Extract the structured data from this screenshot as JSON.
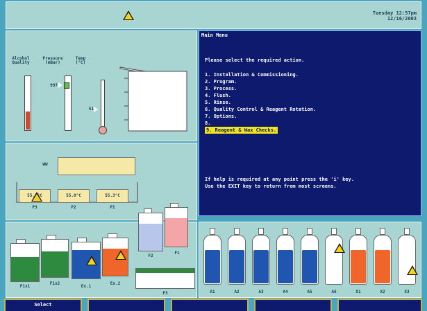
{
  "header": {
    "day_time": "Tuesday 12:57pm",
    "date": "12/16/2003",
    "alert_icon": "warning-triangle-icon"
  },
  "gauges": {
    "alcohol_label": "Alcohol\nQuality",
    "pressure_label": "Pressure\n(mBar)",
    "temp_label": "Temp\n(°C)",
    "pressure_value": "997",
    "temp_value": "51"
  },
  "wax": {
    "label": "WW",
    "reagents": [
      {
        "value": "55.0°C",
        "name": "P3"
      },
      {
        "value": "55.0°C",
        "name": "P2"
      },
      {
        "value": "55.3°C",
        "name": "P1"
      }
    ]
  },
  "menu": {
    "title": "Main Menu",
    "prompt": "Please select the required action.",
    "items": [
      "1. Installation & Commissioning.",
      "2. Program.",
      "3. Process.",
      "4. Flush.",
      "5. Rinse.",
      "6. Quality Control & Reagent Rotation.",
      "7. Options.",
      "8.",
      "9. Reagent & Wax Checks."
    ],
    "help_line1": "If help is required at any point press the 'i' key.",
    "help_line2": "Use the EXIT key to return from most screens."
  },
  "containers": {
    "left": [
      {
        "name": "Fix1",
        "fill_color": "#2e8a3e"
      },
      {
        "name": "Fix2",
        "fill_color": "#2e8a3e"
      },
      {
        "name": "Ex.1",
        "fill_color": "#2055b0"
      },
      {
        "name": "Ex.2",
        "fill_color": "#f0662a"
      }
    ],
    "mid": [
      {
        "name": "F2",
        "fill_color": "#b7c6ea"
      },
      {
        "name": "F1",
        "fill_color": "#f3a5a8"
      },
      {
        "name": "F3",
        "fill_color": "#2e8a3e"
      }
    ],
    "bottles": [
      {
        "name": "A1",
        "fill_color": "#2055b0"
      },
      {
        "name": "A2",
        "fill_color": "#2055b0"
      },
      {
        "name": "A3",
        "fill_color": "#2055b0"
      },
      {
        "name": "A4",
        "fill_color": "#2055b0"
      },
      {
        "name": "A5",
        "fill_color": "#2055b0"
      },
      {
        "name": "A6",
        "fill_color": "#ffffff"
      },
      {
        "name": "X1",
        "fill_color": "#f0662a"
      },
      {
        "name": "X2",
        "fill_color": "#f0662a"
      },
      {
        "name": "X3",
        "fill_color": "#ffffff"
      }
    ]
  },
  "function_keys": [
    "Select",
    "",
    "",
    "",
    ""
  ]
}
